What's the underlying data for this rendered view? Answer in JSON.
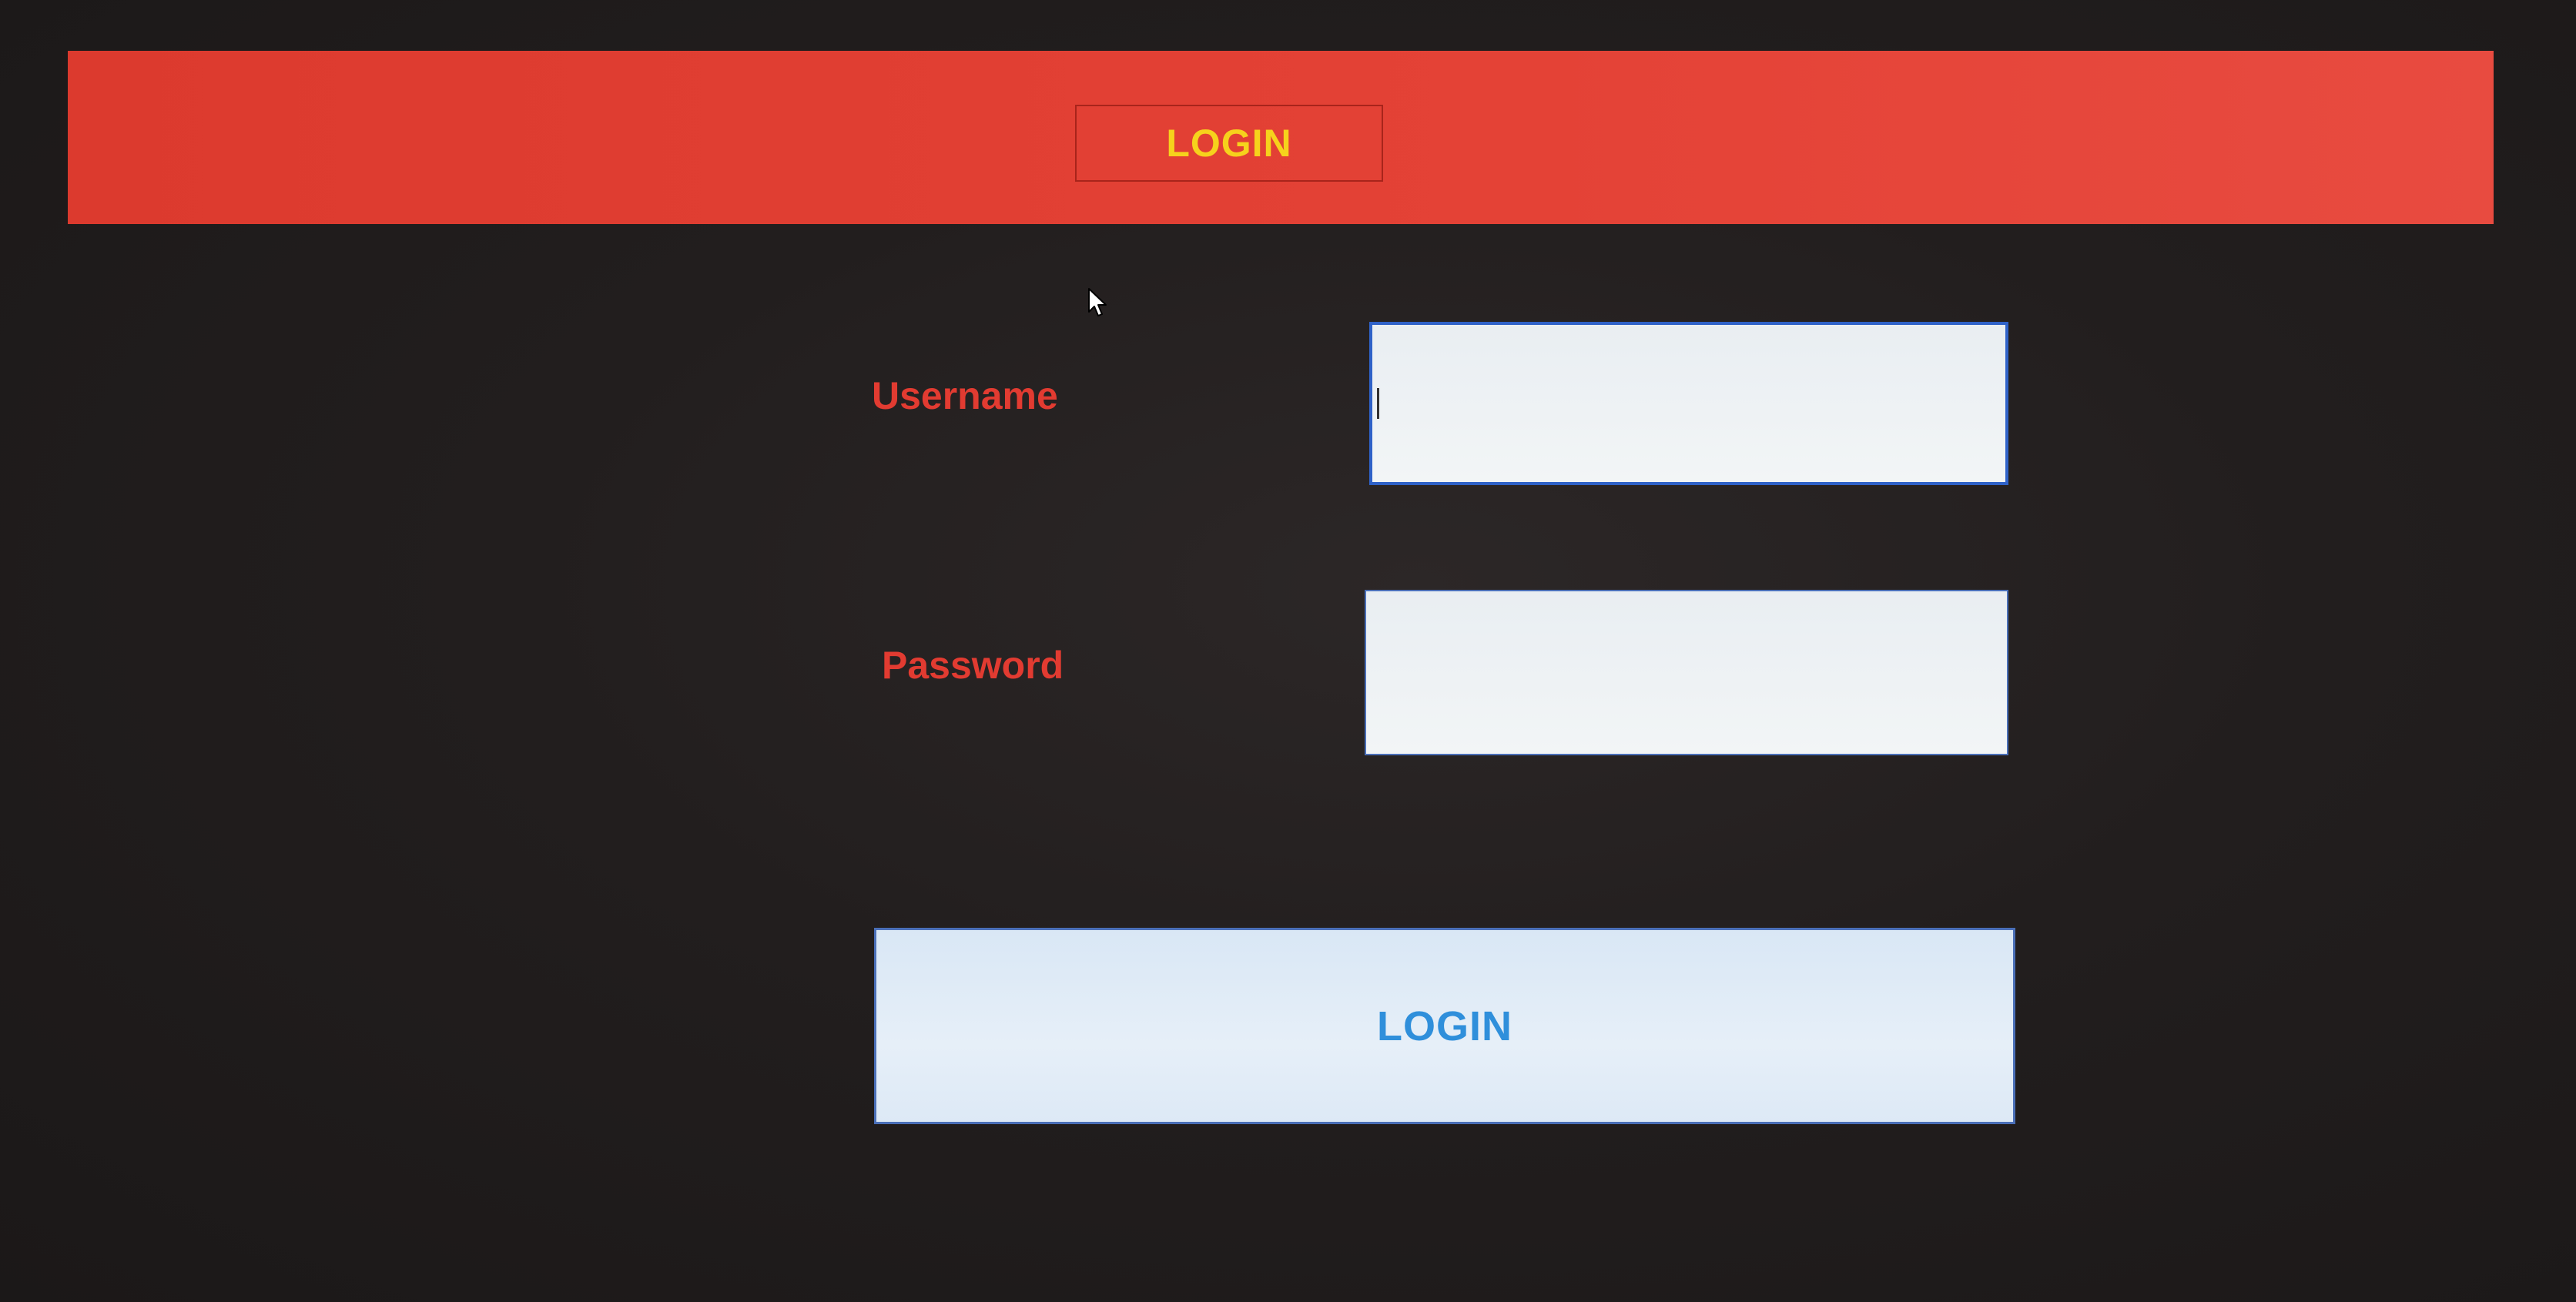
{
  "header": {
    "title": "LOGIN"
  },
  "form": {
    "username": {
      "label": "Username",
      "value": "",
      "placeholder": ""
    },
    "password": {
      "label": "Password",
      "value": "",
      "placeholder": ""
    },
    "submit_label": "LOGIN"
  },
  "colors": {
    "header_bar": "#e2402f",
    "header_title": "#f6d21c",
    "label_text": "#e23b31",
    "button_text": "#2f8fdb",
    "background": "#221e1e",
    "field_border": "#2f62c8"
  },
  "icons": {
    "mouse_cursor": "arrow-cursor-icon"
  }
}
